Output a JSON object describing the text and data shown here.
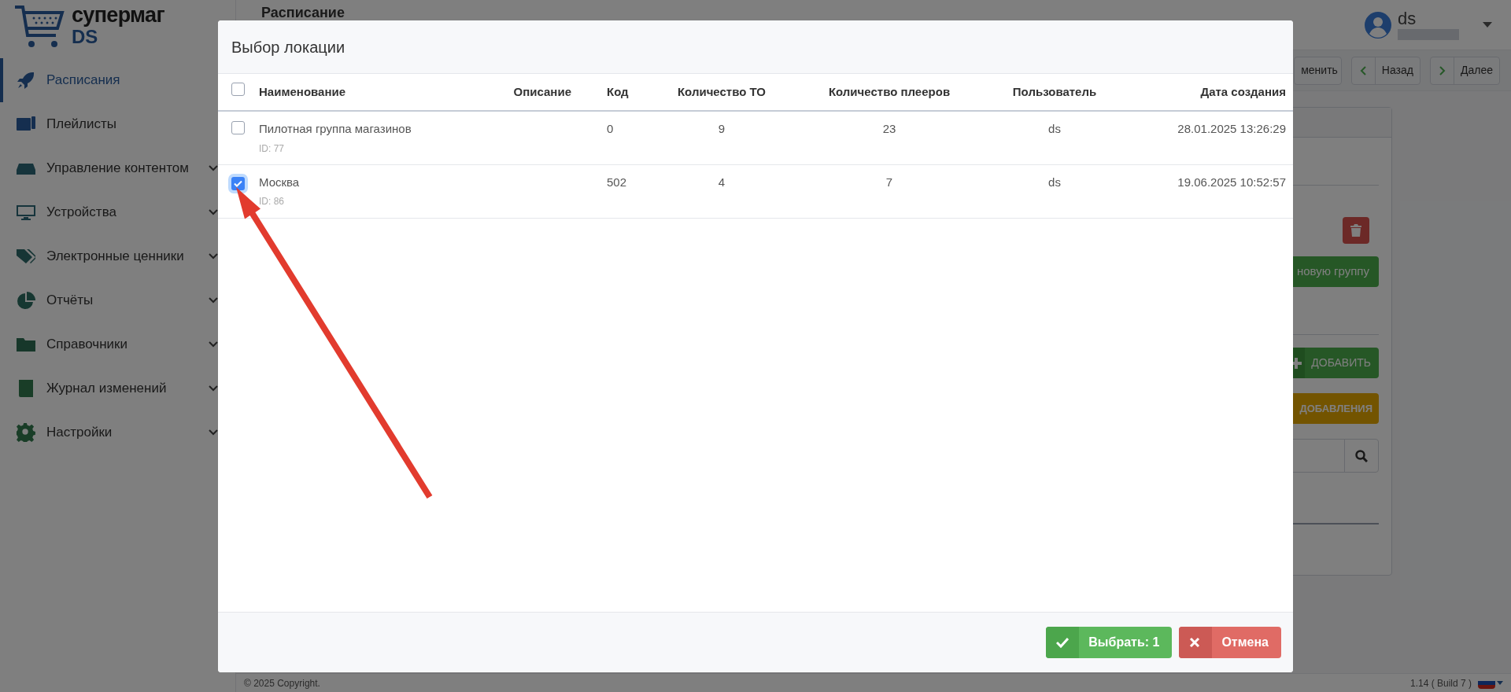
{
  "logo": {
    "title": "супермаг",
    "subtitle": "DS"
  },
  "sidebar": {
    "items": [
      {
        "label": "Расписания",
        "selected": true,
        "expandable": false
      },
      {
        "label": "Плейлисты",
        "selected": false,
        "expandable": false
      },
      {
        "label": "Управление контентом",
        "selected": false,
        "expandable": true
      },
      {
        "label": "Устройства",
        "selected": false,
        "expandable": true
      },
      {
        "label": "Электронные ценники",
        "selected": false,
        "expandable": true
      },
      {
        "label": "Отчёты",
        "selected": false,
        "expandable": true
      },
      {
        "label": "Справочники",
        "selected": false,
        "expandable": true
      },
      {
        "label": "Журнал изменений",
        "selected": false,
        "expandable": true
      },
      {
        "label": "Настройки",
        "selected": false,
        "expandable": true
      }
    ]
  },
  "page_title": "Расписание",
  "user": {
    "name": "ds"
  },
  "toolbar": {
    "buttons": [
      {
        "label": "менить",
        "kind": "plain"
      },
      {
        "label": "Назад",
        "kind": "back"
      },
      {
        "label": "Далее",
        "kind": "next"
      }
    ]
  },
  "card": {
    "buttons": [
      {
        "label": "новую группу",
        "kind": "success"
      },
      {
        "label": "ДОБАВИТЬ",
        "kind": "add"
      },
      {
        "label": "ДОБАВЛЕНИЯ",
        "kind": "warning"
      }
    ]
  },
  "modal": {
    "title": "Выбор локации",
    "select_all": {
      "checked": false
    },
    "columns": [
      "Наименование",
      "Описание",
      "Код",
      "Количество ТО",
      "Количество плееров",
      "Пользователь",
      "Дата создания"
    ],
    "rows": [
      {
        "name": "Пилотная группа магазинов",
        "id": "ID: 77",
        "code": "0",
        "to_count": "9",
        "players": "23",
        "user": "ds",
        "created": "28.01.2025 13:26:29",
        "checked": false
      },
      {
        "name": "Москва",
        "id": "ID: 86",
        "code": "502",
        "to_count": "4",
        "players": "7",
        "user": "ds",
        "created": "19.06.2025 10:52:57",
        "checked": true
      }
    ],
    "buttons": [
      {
        "label": "Выбрать: 1",
        "kind": "confirm"
      },
      {
        "label": "Отмена",
        "kind": "cancel"
      }
    ]
  },
  "footer": {
    "copyright": "© 2025 Copyright.",
    "version": "1.14 ( Build 7 )"
  }
}
